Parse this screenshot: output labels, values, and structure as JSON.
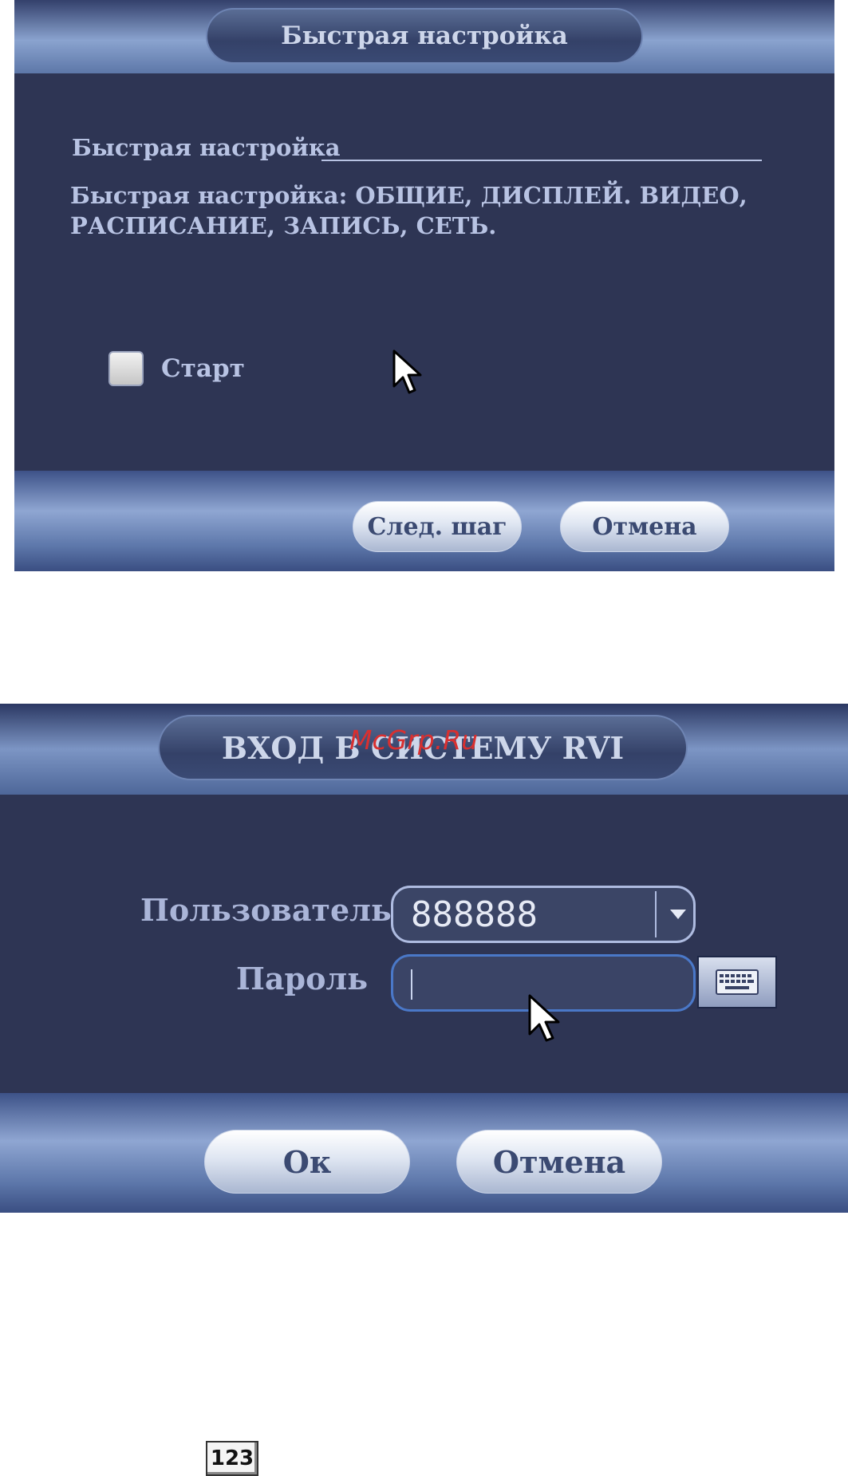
{
  "quick_setup_dialog": {
    "title": "Быстрая настройка",
    "section_title": "Быстрая настройка",
    "description": "Быстрая настройка: ОБЩИЕ, ДИСПЛЕЙ. ВИДЕО, РАСПИСАНИЕ, ЗАПИСЬ, СЕТЬ.",
    "start_checkbox": {
      "label": "Старт",
      "checked": false
    },
    "next_button_label": "След. шаг",
    "cancel_button_label": "Отмена"
  },
  "login_dialog": {
    "title": "ВХОД В СИСТЕМУ RVI",
    "watermark": "McGrp.Ru",
    "user_label": "Пользователь",
    "user_value": "888888",
    "password_label": "Пароль",
    "password_value": "",
    "ok_button_label": "Ок",
    "cancel_button_label": "Отмена"
  },
  "bottom_icon": {
    "label": "123",
    "icon": "numeric-input-icon"
  },
  "colors": {
    "dialog_body": "#2e3554",
    "label_text": "#b8c3e3",
    "input_focus_border": "#4a78c8",
    "watermark": "#d83030"
  }
}
